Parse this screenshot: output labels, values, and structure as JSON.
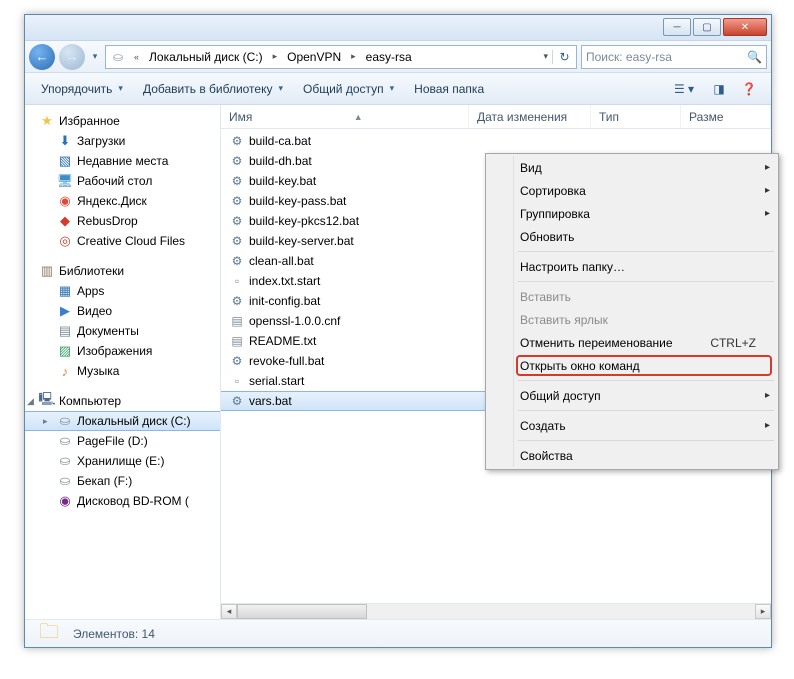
{
  "titlebar": {
    "min": "─",
    "max": "▢",
    "close": "✕"
  },
  "nav": {
    "back": "←",
    "fwd": "→",
    "crumbs": [
      "Локальный диск (C:)",
      "OpenVPN",
      "easy-rsa"
    ],
    "refresh": "↻",
    "search_placeholder": "Поиск: easy-rsa"
  },
  "toolbar": {
    "organize": "Упорядочить",
    "library": "Добавить в библиотеку",
    "share": "Общий доступ",
    "newfolder": "Новая папка"
  },
  "columns": {
    "name": "Имя",
    "date": "Дата изменения",
    "type": "Тип",
    "size": "Разме"
  },
  "sidebar": {
    "fav": "Избранное",
    "fav_items": [
      {
        "ico": "⬇",
        "cls": "ico-blue",
        "label": "Загрузки"
      },
      {
        "ico": "▧",
        "cls": "ico-blue",
        "label": "Недавние места"
      },
      {
        "ico": "🖥",
        "cls": "ico-desk",
        "label": "Рабочий стол"
      },
      {
        "ico": "◉",
        "cls": "ico-yd",
        "label": "Яндекс.Диск"
      },
      {
        "ico": "◆",
        "cls": "ico-red",
        "label": "RebusDrop"
      },
      {
        "ico": "◎",
        "cls": "ico-red",
        "label": "Creative Cloud Files"
      }
    ],
    "lib": "Библиотеки",
    "lib_items": [
      {
        "ico": "▦",
        "cls": "ico-blue",
        "label": "Apps"
      },
      {
        "ico": "▶",
        "cls": "ico-video",
        "label": "Видео"
      },
      {
        "ico": "▤",
        "cls": "ico-doc",
        "label": "Документы"
      },
      {
        "ico": "▨",
        "cls": "ico-img",
        "label": "Изображения"
      },
      {
        "ico": "♪",
        "cls": "ico-music",
        "label": "Музыка"
      }
    ],
    "comp": "Компьютер",
    "comp_items": [
      {
        "ico": "⛀",
        "cls": "ico-disk",
        "label": "Локальный диск (C:)",
        "sel": true
      },
      {
        "ico": "⛀",
        "cls": "ico-disk",
        "label": "PageFile (D:)"
      },
      {
        "ico": "⛀",
        "cls": "ico-disk",
        "label": "Хранилище (E:)"
      },
      {
        "ico": "⛀",
        "cls": "ico-disk",
        "label": "Бекап (F:)"
      },
      {
        "ico": "◉",
        "cls": "ico-bd",
        "label": "Дисковод BD-ROM ("
      }
    ]
  },
  "files": [
    {
      "ico": "⚙",
      "cls": "ico-bat",
      "name": "build-ca.bat"
    },
    {
      "ico": "⚙",
      "cls": "ico-bat",
      "name": "build-dh.bat"
    },
    {
      "ico": "⚙",
      "cls": "ico-bat",
      "name": "build-key.bat"
    },
    {
      "ico": "⚙",
      "cls": "ico-bat",
      "name": "build-key-pass.bat"
    },
    {
      "ico": "⚙",
      "cls": "ico-bat",
      "name": "build-key-pkcs12.bat"
    },
    {
      "ico": "⚙",
      "cls": "ico-bat",
      "name": "build-key-server.bat"
    },
    {
      "ico": "⚙",
      "cls": "ico-bat",
      "name": "clean-all.bat"
    },
    {
      "ico": "▫",
      "cls": "ico-start",
      "name": "index.txt.start"
    },
    {
      "ico": "⚙",
      "cls": "ico-bat",
      "name": "init-config.bat"
    },
    {
      "ico": "▤",
      "cls": "ico-cnf",
      "name": "openssl-1.0.0.cnf"
    },
    {
      "ico": "▤",
      "cls": "ico-cnf",
      "name": "README.txt"
    },
    {
      "ico": "⚙",
      "cls": "ico-bat",
      "name": "revoke-full.bat"
    },
    {
      "ico": "▫",
      "cls": "ico-start",
      "name": "serial.start"
    },
    {
      "ico": "⚙",
      "cls": "ico-bat",
      "name": "vars.bat",
      "sel": true
    }
  ],
  "context": {
    "view": "Вид",
    "sort": "Сортировка",
    "group": "Группировка",
    "refresh": "Обновить",
    "customize": "Настроить папку…",
    "paste": "Вставить",
    "paste_lnk": "Вставить ярлык",
    "undo_rename": "Отменить переименование",
    "undo_short": "CTRL+Z",
    "open_cmd": "Открыть окно команд",
    "share": "Общий доступ",
    "create": "Создать",
    "props": "Свойства"
  },
  "status": {
    "label": "Элементов: 14"
  }
}
